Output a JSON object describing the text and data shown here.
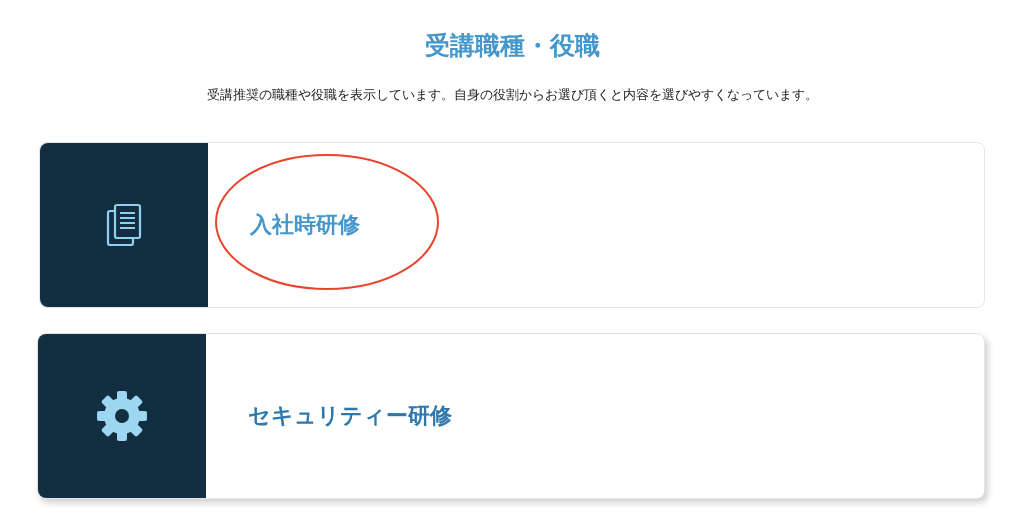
{
  "heading": "受講職種・役職",
  "description": "受講推奨の職種や役職を表示しています。自身の役割からお選び頂くと内容を選びやすくなっています。",
  "cards": [
    {
      "kind": "document",
      "label": "入社時研修",
      "hovered": false,
      "circled": true
    },
    {
      "kind": "gear",
      "label": "セキュリティー研修",
      "hovered": true,
      "circled": false
    }
  ]
}
